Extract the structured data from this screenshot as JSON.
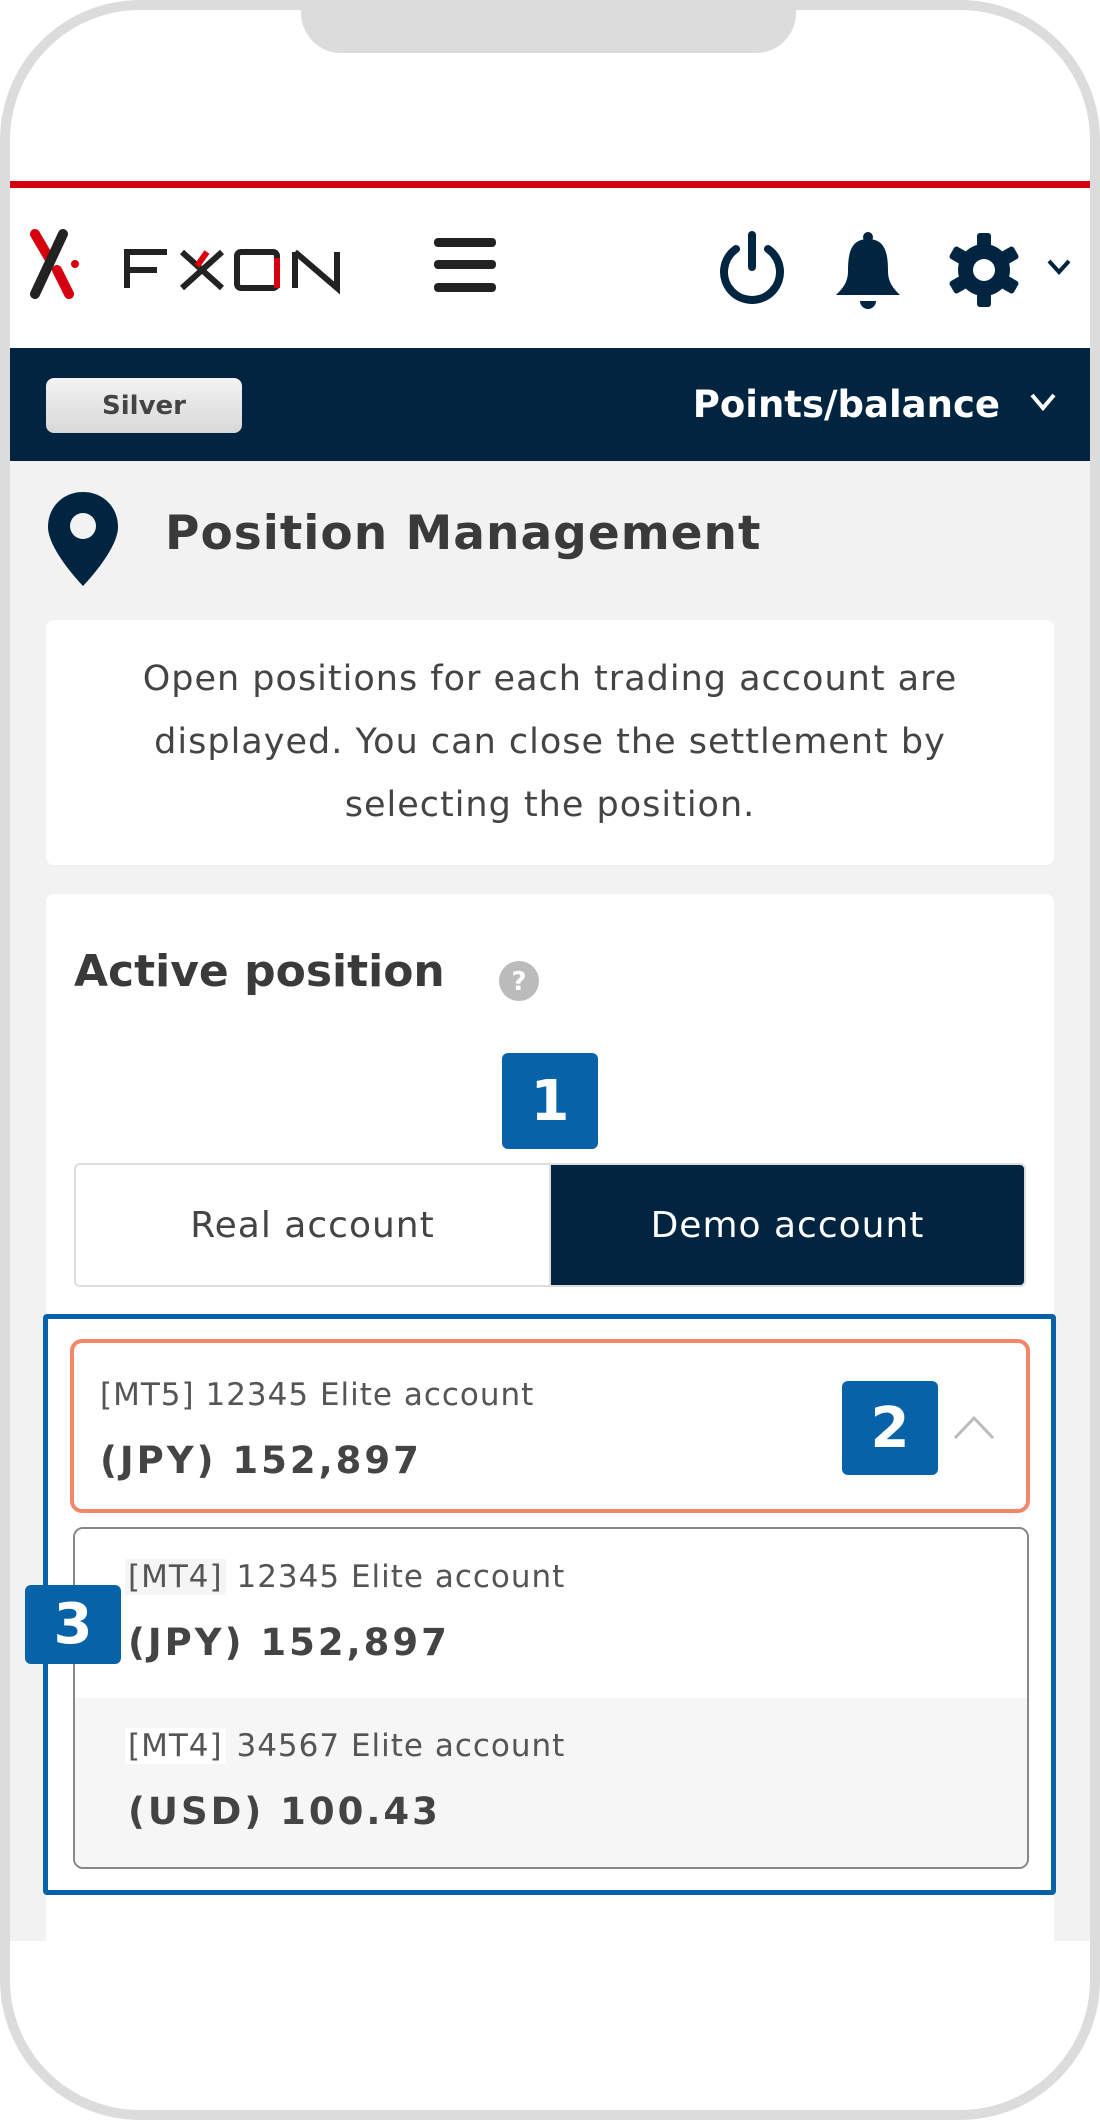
{
  "header": {
    "logo_text": "FXON",
    "icons": [
      "hamburger-menu-icon",
      "power-icon",
      "bell-icon",
      "gear-icon",
      "chevron-down-icon"
    ]
  },
  "navbar": {
    "rank_label": "Silver",
    "points_label": "Points/balance"
  },
  "page": {
    "title": "Position Management",
    "description": "Open positions for each trading account are displayed. You can close the settlement by selecting the position."
  },
  "active": {
    "heading": "Active position",
    "tabs": [
      {
        "label": "Real account",
        "selected": false
      },
      {
        "label": "Demo account",
        "selected": true
      }
    ],
    "selected_account": {
      "platform": "[MT5]",
      "name": "12345 Elite account",
      "balance": "(JPY) 152,897"
    },
    "options": [
      {
        "platform": "[MT4]",
        "name": "12345 Elite account",
        "balance": "(JPY) 152,897"
      },
      {
        "platform": "[MT4]",
        "name": "34567 Elite account",
        "balance": "(USD) 100.43"
      }
    ]
  },
  "annotations": {
    "one": "1",
    "two": "2",
    "three": "3"
  },
  "colors": {
    "navy": "#012540",
    "brand_red": "#d7000f",
    "annotation_blue": "#0762a8",
    "highlight_orange": "#f4876a"
  }
}
